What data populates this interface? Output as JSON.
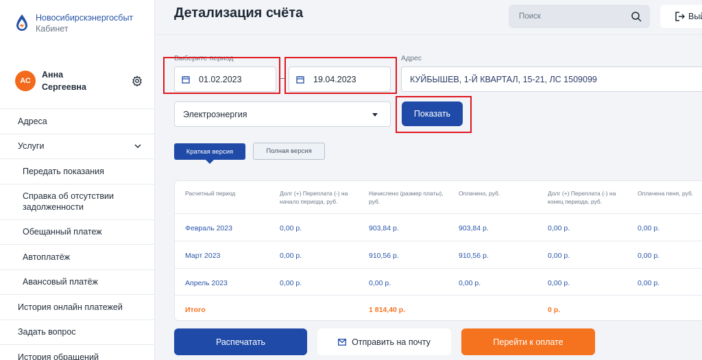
{
  "app": {
    "logo_title": "Новосибирскэнергосбыт",
    "logo_subtitle": "Кабинет"
  },
  "user": {
    "initials": "АС",
    "first_name": "Анна",
    "last_name": "Сергеевна"
  },
  "sidebar": {
    "items": [
      {
        "label": "Адреса"
      },
      {
        "label": "Услуги"
      },
      {
        "label": "Передать показания"
      },
      {
        "label": "Справка об отсутствии задолженности"
      },
      {
        "label": "Обещанный платеж"
      },
      {
        "label": "Автоплатёж"
      },
      {
        "label": "Авансовый платёж"
      },
      {
        "label": "История онлайн платежей"
      },
      {
        "label": "Задать вопрос"
      },
      {
        "label": "История обращений"
      }
    ]
  },
  "header": {
    "title": "Детализация счёта",
    "search_placeholder": "Поиск",
    "exit_label": "Вый"
  },
  "filters": {
    "period_label": "Выберите период",
    "date_from": "01.02.2023",
    "date_to": "19.04.2023",
    "address_label": "Адрес",
    "address_value": "КУЙБЫШЕВ, 1-Й КВАРТАЛ, 15-21, ЛС 1509099",
    "service_value": "Электроэнергия",
    "show_label": "Показать"
  },
  "tabs": {
    "short": "Краткая версия",
    "full": "Полная версия"
  },
  "table": {
    "headers": [
      "Расчетный период",
      "Долг (+) Переплата (-) на начало периода, руб.",
      "Начислено (размер платы), руб.",
      "Оплачено, руб.",
      "Долг (+) Переплата (-) на конец периода, руб.",
      "Оплачена пеня, руб."
    ],
    "rows": [
      [
        "Февраль 2023",
        "0,00 р.",
        "903,84 р.",
        "903,84 р.",
        "0,00 р.",
        "0,00 р."
      ],
      [
        "Март 2023",
        "0,00 р.",
        "910,56 р.",
        "910,56 р.",
        "0,00 р.",
        "0,00 р."
      ],
      [
        "Апрель 2023",
        "0,00 р.",
        "0,00 р.",
        "0,00 р.",
        "0,00 р.",
        "0,00 р."
      ]
    ],
    "total": {
      "label": "Итого",
      "charged": "1 814,40 р.",
      "end_debt": "0 р."
    }
  },
  "actions": {
    "print": "Распечатать",
    "email": "Отправить на почту",
    "pay": "Перейти к оплате"
  },
  "colors": {
    "primary": "#1f4aa8",
    "accent": "#f5731f",
    "highlight": "#e0141c"
  }
}
